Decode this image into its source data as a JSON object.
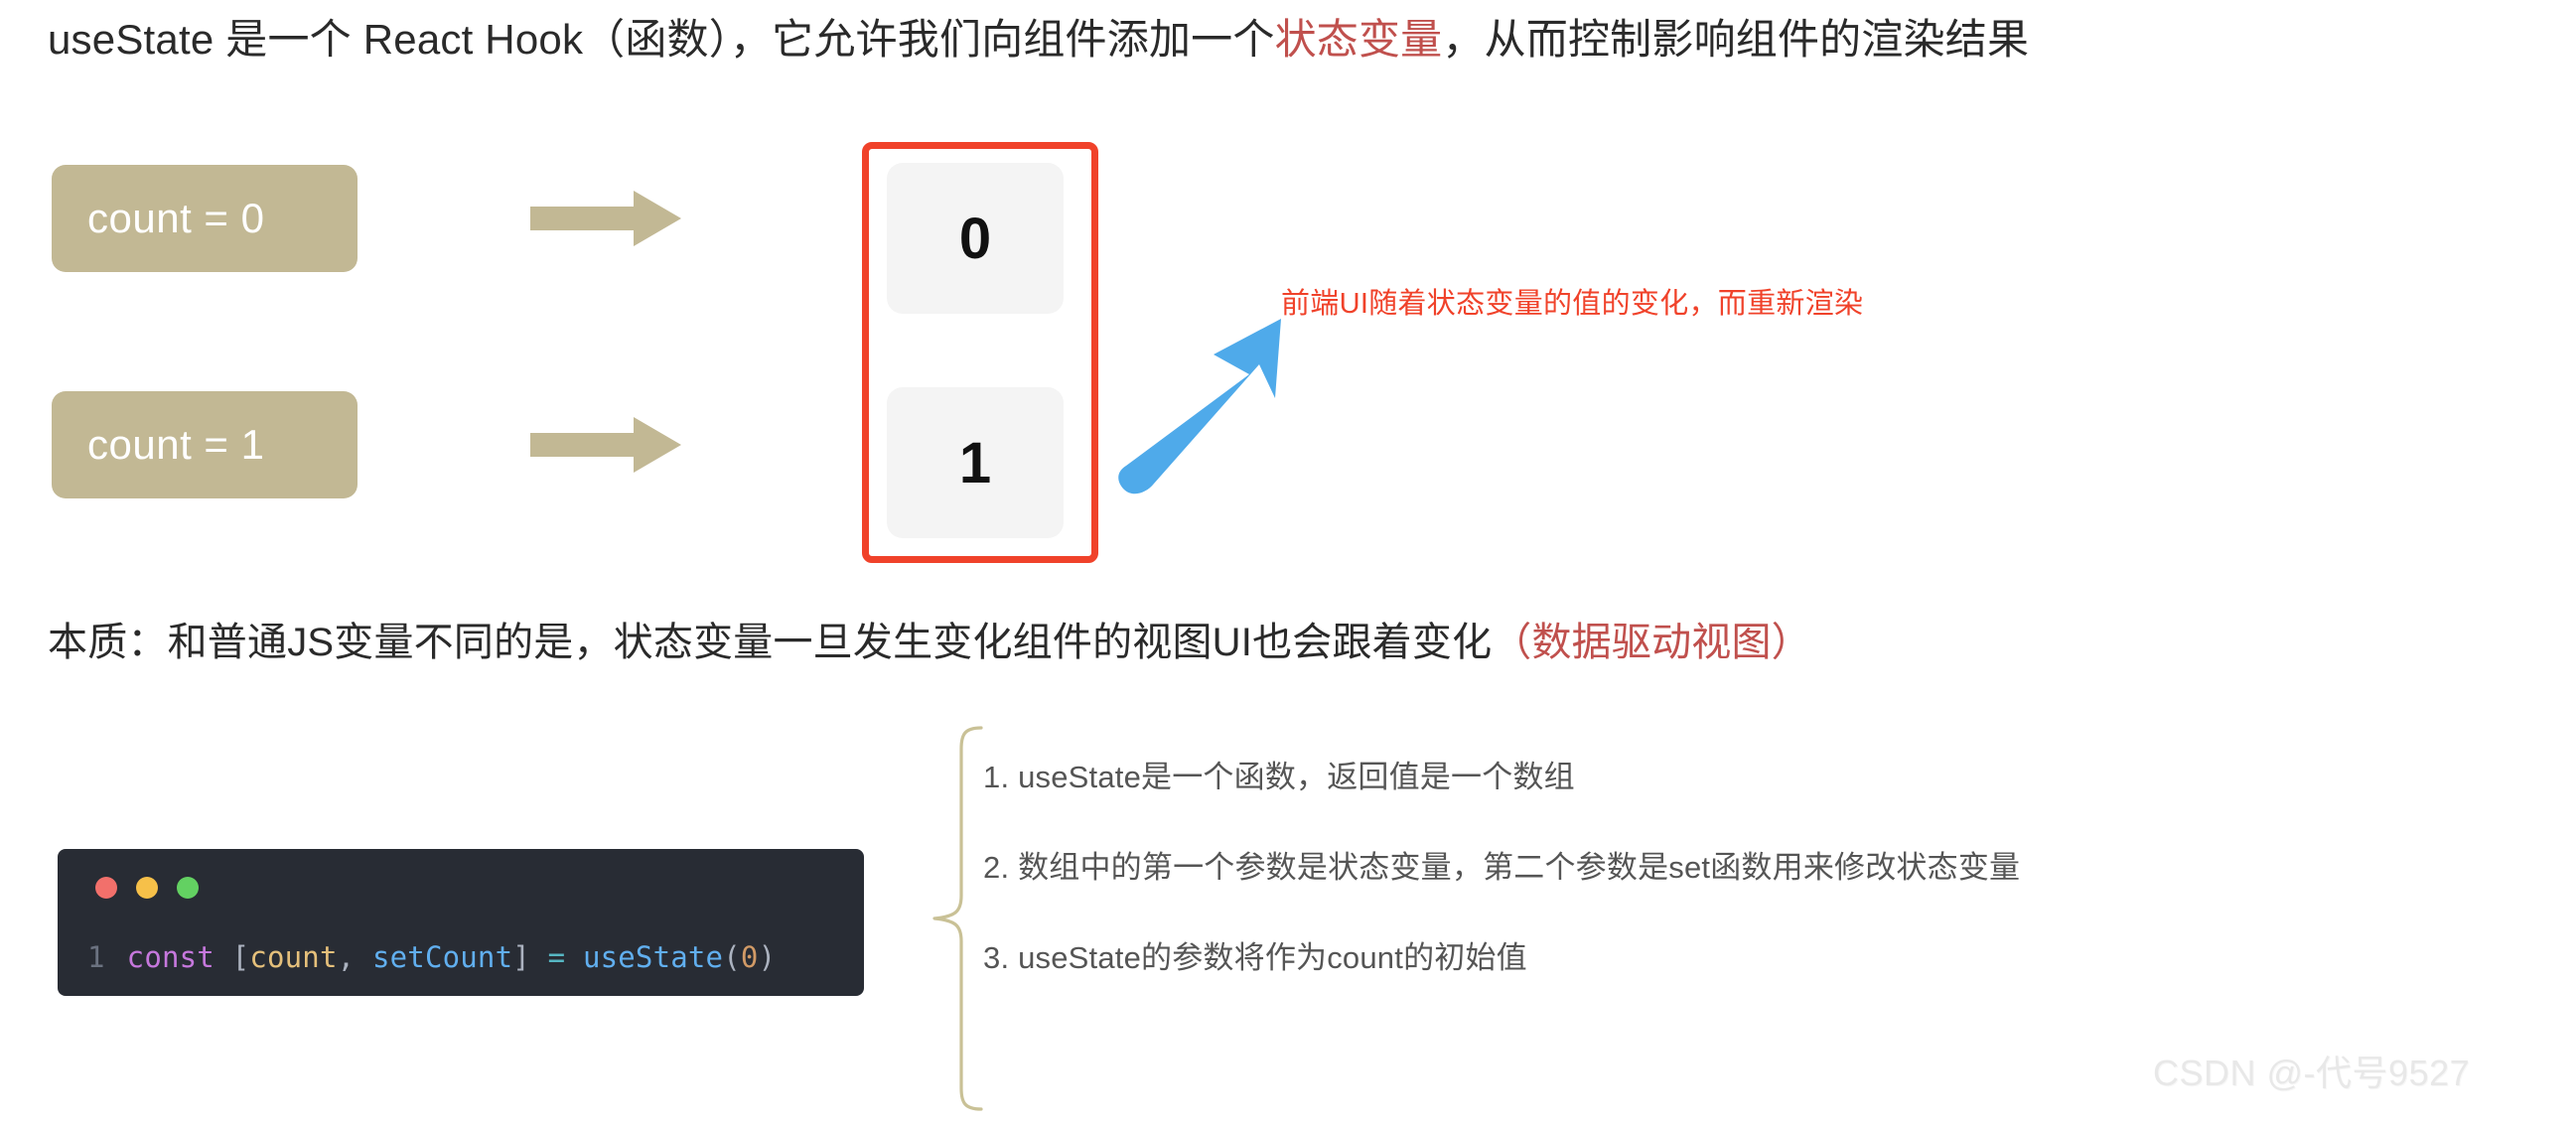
{
  "headline": {
    "part1": "useState 是一个 React Hook（函数），它允许我们向组件添加一个",
    "highlight": "状态变量",
    "part2": "，从而控制影响组件的渲染结果"
  },
  "flow": {
    "states": [
      {
        "label": "count = 0",
        "arrow_icon": "right-arrow-icon"
      },
      {
        "label": "count = 1",
        "arrow_icon": "right-arrow-icon"
      }
    ],
    "ui_panel": {
      "cells": [
        "0",
        "1"
      ],
      "border_color": "#f0422a"
    },
    "annotation": {
      "text": "前端UI随着状态变量的值的变化，而重新渲染",
      "color": "#f0422a",
      "arrow_icon": "blue-diagonal-arrow-icon",
      "arrow_color": "#4faaea"
    },
    "box_color": "#c2b894"
  },
  "essence": {
    "part1": "本质：和普通JS变量不同的是，状态变量一旦发生变化组件的视图UI也会跟着变化",
    "highlight": "（数据驱动视图）"
  },
  "code": {
    "window_dots": [
      "red",
      "yellow",
      "green"
    ],
    "line_number": "1",
    "tokens": [
      {
        "text": "const",
        "type": "keyword"
      },
      {
        "text": " ",
        "type": "plain"
      },
      {
        "text": "[",
        "type": "punct"
      },
      {
        "text": "count",
        "type": "variable"
      },
      {
        "text": ", ",
        "type": "punct"
      },
      {
        "text": "setCount",
        "type": "function"
      },
      {
        "text": "]",
        "type": "punct"
      },
      {
        "text": " ",
        "type": "plain"
      },
      {
        "text": "=",
        "type": "operator"
      },
      {
        "text": " ",
        "type": "plain"
      },
      {
        "text": "useState",
        "type": "function"
      },
      {
        "text": "(",
        "type": "punct"
      },
      {
        "text": "0",
        "type": "number"
      },
      {
        "text": ")",
        "type": "punct"
      }
    ],
    "full_line": "const [count, setCount] = useState(0)"
  },
  "notes": [
    "1. useState是一个函数，返回值是一个数组",
    "2. 数组中的第一个参数是状态变量，第二个参数是set函数用来修改状态变量",
    "3. useState的参数将作为count的初始值"
  ],
  "watermark": "CSDN @-代号9527"
}
